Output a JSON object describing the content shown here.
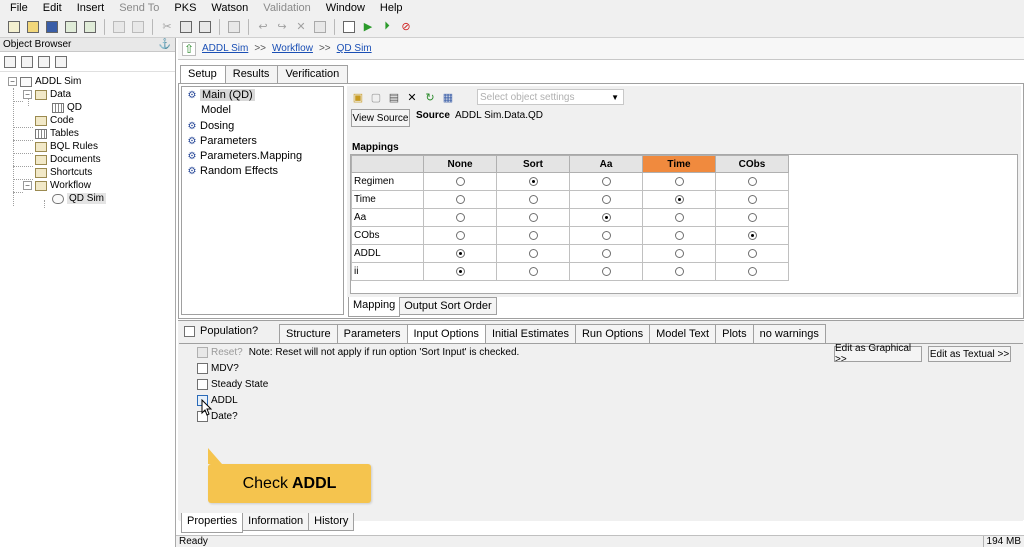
{
  "menu": [
    "File",
    "Edit",
    "Insert",
    "Send To",
    "PKS",
    "Watson",
    "Validation",
    "Window",
    "Help"
  ],
  "menu_disabled": [
    "Send To",
    "Validation"
  ],
  "object_browser": {
    "title": "Object Browser",
    "pin": "⚓",
    "tree": [
      {
        "label": "ADDL Sim"
      },
      {
        "label": "Data"
      },
      {
        "label": "QD"
      },
      {
        "label": "Code"
      },
      {
        "label": "Tables"
      },
      {
        "label": "BQL Rules"
      },
      {
        "label": "Documents"
      },
      {
        "label": "Shortcuts"
      },
      {
        "label": "Workflow"
      },
      {
        "label": "QD Sim"
      }
    ]
  },
  "breadcrumb": {
    "items": [
      "ADDL Sim",
      "Workflow",
      "QD Sim"
    ],
    "sep": ">>"
  },
  "top_tabs": [
    "Setup",
    "Results",
    "Verification"
  ],
  "setup_list": [
    {
      "label": "Main (QD)",
      "icon": "⚙"
    },
    {
      "label": "Model",
      "icon": ""
    },
    {
      "label": "Dosing",
      "icon": "⚙"
    },
    {
      "label": "Parameters",
      "icon": "⚙"
    },
    {
      "label": "Parameters.Mapping",
      "icon": "⚙"
    },
    {
      "label": "Random Effects",
      "icon": "⚙"
    }
  ],
  "select_object_placeholder": "Select object settings",
  "view_source_label": "View Source",
  "source_label": "Source",
  "source_value": "ADDL Sim.Data.QD",
  "mappings_label": "Mappings",
  "mapping_columns": [
    "None",
    "Sort",
    "Aa",
    "Time",
    "CObs"
  ],
  "mapping_rows": [
    {
      "label": "Regimen",
      "selected": 1
    },
    {
      "label": "Time",
      "selected": 3
    },
    {
      "label": "Aa",
      "selected": 2
    },
    {
      "label": "CObs",
      "selected": 4
    },
    {
      "label": "ADDL",
      "selected": 0
    },
    {
      "label": "ii",
      "selected": 0
    }
  ],
  "highlight_column": "Time",
  "highlight_color": "#f08a3e",
  "sub_tabs": [
    "Mapping",
    "Output Sort Order"
  ],
  "population_label": "Population?",
  "bottom_tabs": [
    "Structure",
    "Parameters",
    "Input Options",
    "Initial Estimates",
    "Run Options",
    "Model Text",
    "Plots",
    "no warnings"
  ],
  "options": {
    "reset_label": "Reset?",
    "reset_note": "Note: Reset will not apply if run option 'Sort Input' is checked.",
    "mdv_label": "MDV?",
    "steady_state_label": "Steady State",
    "addl_label": "ADDL",
    "date_label": "Date?"
  },
  "edit_graphical_label": "Edit as Graphical >>",
  "edit_textual_label": "Edit as Textual >>",
  "callout": {
    "prefix": "Check",
    "bold": "ADDL",
    "color": "#f5c44e"
  },
  "property_tabs": [
    "Properties",
    "Information",
    "History"
  ],
  "status": {
    "text": "Ready",
    "memory": "194 MB"
  }
}
